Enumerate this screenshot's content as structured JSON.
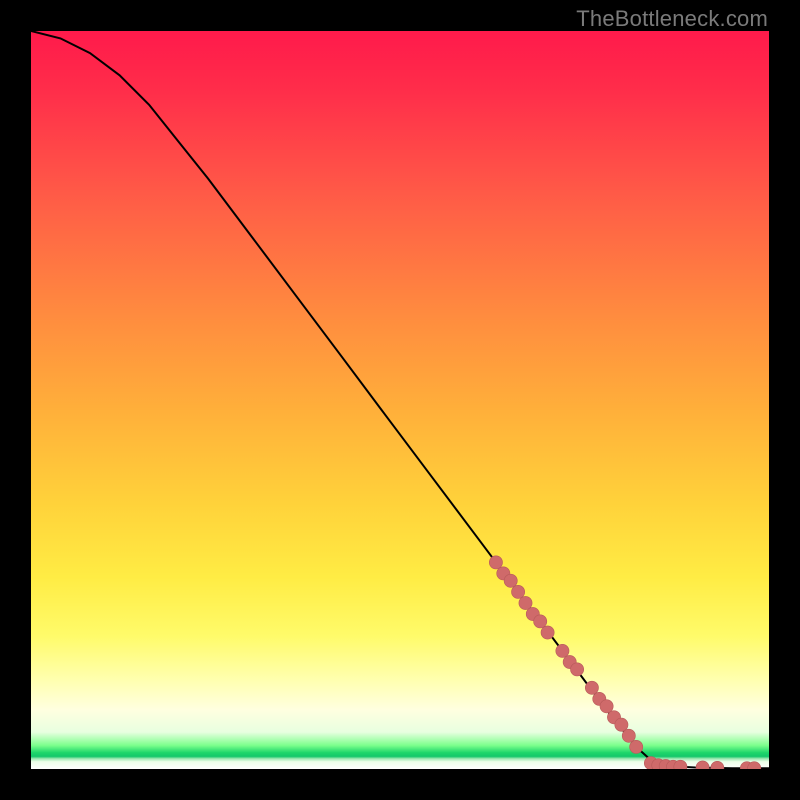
{
  "watermark": "TheBottleneck.com",
  "colors": {
    "marker_fill": "#cf6a6a",
    "marker_stroke": "#b85a5a",
    "curve_stroke": "#000000",
    "frame_bg": "#000000"
  },
  "chart_data": {
    "type": "line",
    "title": "",
    "xlabel": "",
    "ylabel": "",
    "xlim": [
      0,
      100
    ],
    "ylim": [
      0,
      100
    ],
    "grid": false,
    "legend": false,
    "curve": [
      {
        "x": 0,
        "y": 100
      },
      {
        "x": 4,
        "y": 99
      },
      {
        "x": 8,
        "y": 97
      },
      {
        "x": 12,
        "y": 94
      },
      {
        "x": 16,
        "y": 90
      },
      {
        "x": 20,
        "y": 85
      },
      {
        "x": 24,
        "y": 80
      },
      {
        "x": 30,
        "y": 72
      },
      {
        "x": 36,
        "y": 64
      },
      {
        "x": 42,
        "y": 56
      },
      {
        "x": 48,
        "y": 48
      },
      {
        "x": 54,
        "y": 40
      },
      {
        "x": 60,
        "y": 32
      },
      {
        "x": 66,
        "y": 24
      },
      {
        "x": 72,
        "y": 16
      },
      {
        "x": 78,
        "y": 8
      },
      {
        "x": 82,
        "y": 3
      },
      {
        "x": 84,
        "y": 1.2
      },
      {
        "x": 86,
        "y": 0.4
      },
      {
        "x": 90,
        "y": 0.2
      },
      {
        "x": 95,
        "y": 0.1
      },
      {
        "x": 100,
        "y": 0.1
      }
    ],
    "markers": [
      {
        "x": 63,
        "y": 28
      },
      {
        "x": 64,
        "y": 26.5
      },
      {
        "x": 65,
        "y": 25.5
      },
      {
        "x": 66,
        "y": 24
      },
      {
        "x": 67,
        "y": 22.5
      },
      {
        "x": 68,
        "y": 21
      },
      {
        "x": 69,
        "y": 20
      },
      {
        "x": 70,
        "y": 18.5
      },
      {
        "x": 72,
        "y": 16
      },
      {
        "x": 73,
        "y": 14.5
      },
      {
        "x": 74,
        "y": 13.5
      },
      {
        "x": 76,
        "y": 11
      },
      {
        "x": 77,
        "y": 9.5
      },
      {
        "x": 78,
        "y": 8.5
      },
      {
        "x": 79,
        "y": 7
      },
      {
        "x": 80,
        "y": 6
      },
      {
        "x": 81,
        "y": 4.5
      },
      {
        "x": 82,
        "y": 3
      },
      {
        "x": 84,
        "y": 0.8
      },
      {
        "x": 85,
        "y": 0.5
      },
      {
        "x": 86,
        "y": 0.4
      },
      {
        "x": 87,
        "y": 0.3
      },
      {
        "x": 88,
        "y": 0.3
      },
      {
        "x": 91,
        "y": 0.2
      },
      {
        "x": 93,
        "y": 0.15
      },
      {
        "x": 97,
        "y": 0.1
      },
      {
        "x": 98,
        "y": 0.1
      }
    ],
    "marker_radius_pct": 0.9
  }
}
